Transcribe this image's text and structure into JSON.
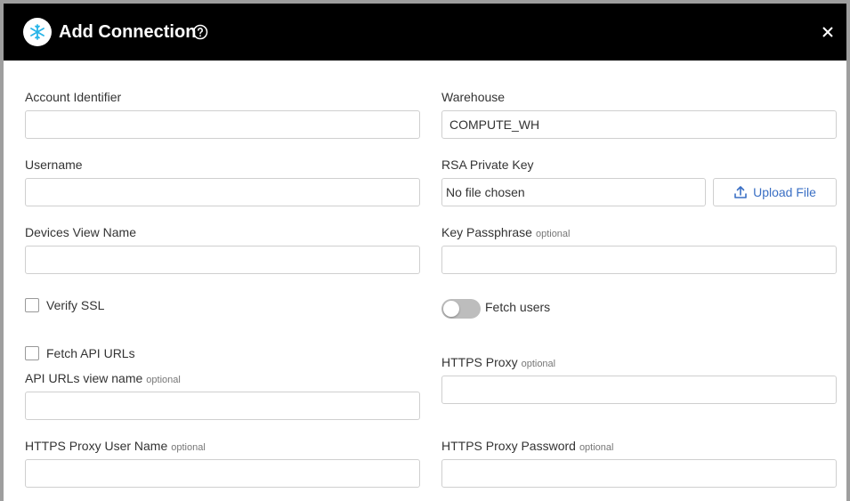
{
  "dialog": {
    "title": "Add Connection",
    "brand_icon": "snowflake-icon",
    "help_icon": "help-circle-icon",
    "close_icon": "close-icon",
    "header_color": "#000000"
  },
  "optional_tag": "optional",
  "fields": {
    "account_identifier": {
      "label": "Account Identifier",
      "value": ""
    },
    "warehouse": {
      "label": "Warehouse",
      "value": "COMPUTE_WH"
    },
    "username": {
      "label": "Username",
      "value": ""
    },
    "rsa_private_key": {
      "label": "RSA Private Key",
      "file_status": "No file chosen",
      "upload_label": "Upload File",
      "upload_icon": "upload-icon"
    },
    "devices_view_name": {
      "label": "Devices View Name",
      "value": ""
    },
    "key_passphrase": {
      "label": "Key Passphrase",
      "value": ""
    },
    "verify_ssl": {
      "label": "Verify SSL",
      "checked": false
    },
    "fetch_users": {
      "label": "Fetch users",
      "on": false
    },
    "fetch_api_urls": {
      "label": "Fetch API URLs",
      "checked": false
    },
    "api_urls_view_name": {
      "label": "API URLs view name",
      "value": ""
    },
    "https_proxy": {
      "label": "HTTPS Proxy",
      "value": ""
    },
    "https_proxy_user_name": {
      "label": "HTTPS Proxy User Name",
      "value": ""
    },
    "https_proxy_password": {
      "label": "HTTPS Proxy Password",
      "value": ""
    }
  }
}
